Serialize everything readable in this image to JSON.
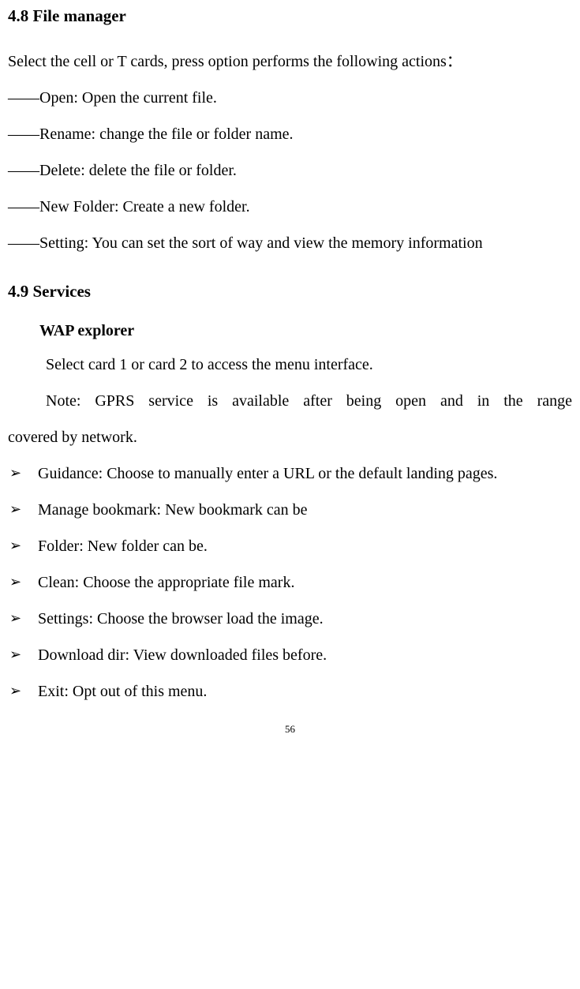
{
  "section48": {
    "title": "4.8 File manager",
    "intro": "Select the cell or T cards, press option performs the following actions：",
    "items": [
      "——Open: Open the current file.",
      "——Rename: change the file or folder name.",
      "——Delete: delete the file or folder.",
      "——New Folder: Create a new folder.",
      "——Setting: You can set the sort of way and view the memory information"
    ]
  },
  "section49": {
    "title": "4.9 Services",
    "subhead": "WAP explorer",
    "line1": "Select card 1 or card 2 to access the menu interface.",
    "note_first": "Note: GPRS service is available after being open and in the range",
    "note_rest": "covered by network.",
    "bullets": [
      "Guidance: Choose to manually enter a URL or the default landing pages.",
      "Manage bookmark: New bookmark can be",
      "Folder: New folder can be.",
      "Clean: Choose the appropriate file mark.",
      "Settings: Choose the browser load the image.",
      "Download dir: View downloaded files before.",
      "Exit: Opt out of this menu."
    ]
  },
  "page_number": "56",
  "bullet_marker": "➢"
}
